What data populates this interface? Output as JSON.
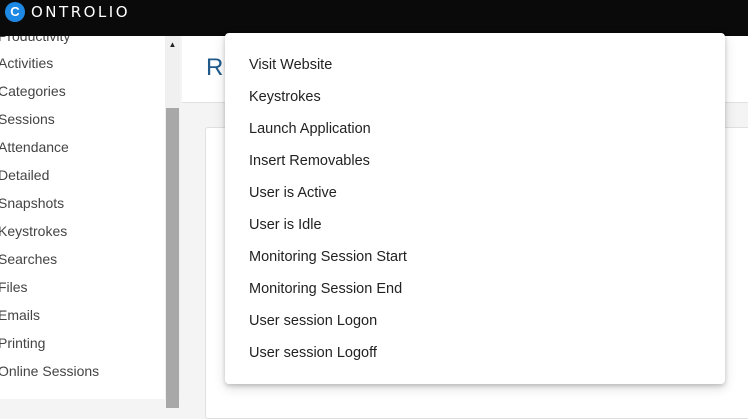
{
  "topbar": {
    "logo_letter": "C",
    "logo_text": "ONTROLIO"
  },
  "sidebar": {
    "items": [
      {
        "label": "Productivity"
      },
      {
        "label": "Activities"
      },
      {
        "label": "Categories"
      },
      {
        "label": "Sessions"
      },
      {
        "label": "Attendance"
      },
      {
        "label": "Detailed"
      },
      {
        "label": "Snapshots"
      },
      {
        "label": "Keystrokes"
      },
      {
        "label": "Searches"
      },
      {
        "label": "Files"
      },
      {
        "label": "Emails"
      },
      {
        "label": "Printing"
      },
      {
        "label": "Online Sessions"
      }
    ]
  },
  "main": {
    "title": "Ru"
  },
  "menu": {
    "items": [
      {
        "label": "Visit Website"
      },
      {
        "label": "Keystrokes"
      },
      {
        "label": "Launch Application"
      },
      {
        "label": "Insert Removables"
      },
      {
        "label": "User is Active"
      },
      {
        "label": "User is Idle"
      },
      {
        "label": "Monitoring Session Start"
      },
      {
        "label": "Monitoring Session End"
      },
      {
        "label": "User session Logon"
      },
      {
        "label": "User session Logoff"
      }
    ]
  }
}
